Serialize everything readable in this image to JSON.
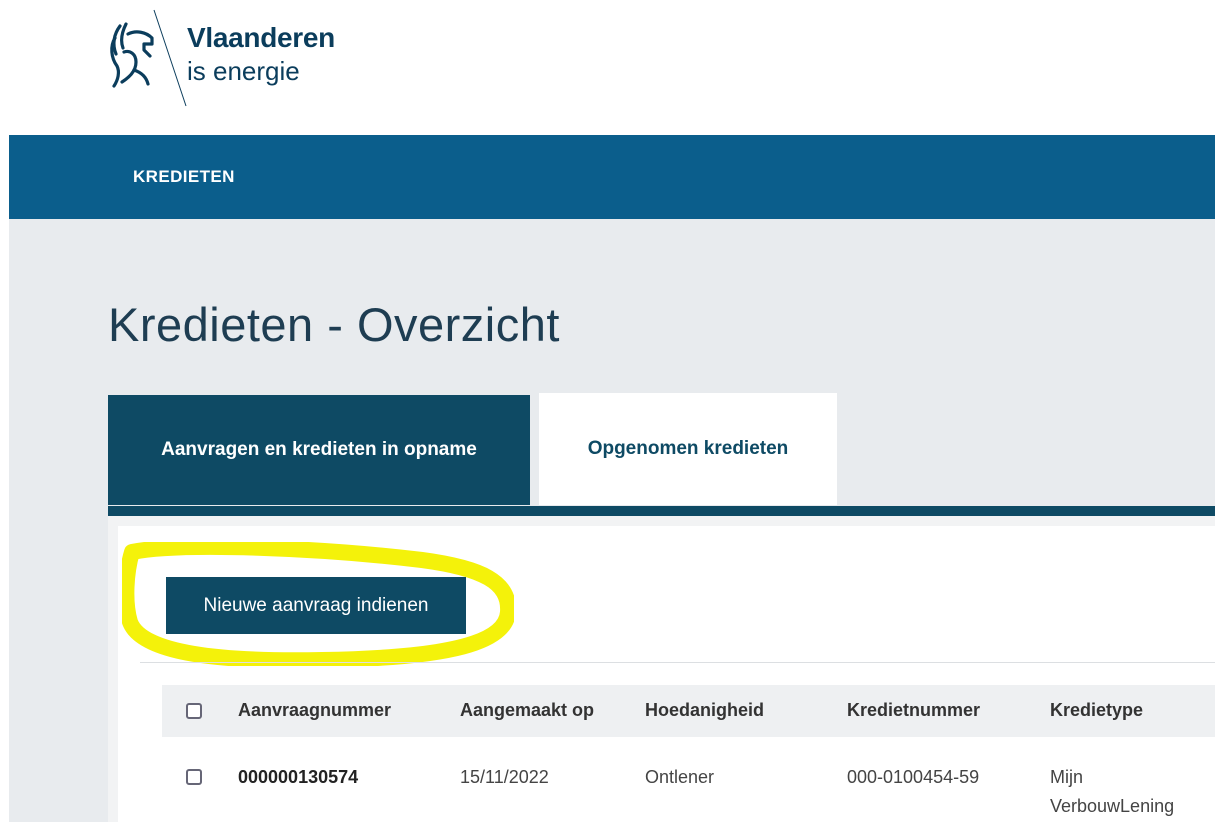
{
  "brand": {
    "title": "Vlaanderen",
    "subtitle": "is energie"
  },
  "nav": {
    "items": [
      {
        "label": "KREDIETEN"
      }
    ]
  },
  "page": {
    "title": "Kredieten - Overzicht"
  },
  "tabs": [
    {
      "label": "Aanvragen en kredieten in opname",
      "active": true
    },
    {
      "label": "Opgenomen kredieten",
      "active": false
    }
  ],
  "actions": {
    "new_request_label": "Nieuwe aanvraag indienen"
  },
  "table": {
    "headers": [
      "Aanvraagnummer",
      "Aangemaakt op",
      "Hoedanigheid",
      "Kredietnummer",
      "Kredietype"
    ],
    "rows": [
      {
        "aanvraagnummer": "000000130574",
        "aangemaakt_op": "15/11/2022",
        "hoedanigheid": "Ontlener",
        "kredietnummer": "000-0100454-59",
        "kredietype": "Mijn VerbouwLening"
      }
    ]
  },
  "colors": {
    "nav_blue": "#0b5e8c",
    "tab_dark": "#0e4a64",
    "highlight": "#f4f20a",
    "content_grey": "#e8ebee"
  },
  "icons": [
    "vlaanderen-lion-logo-icon"
  ]
}
